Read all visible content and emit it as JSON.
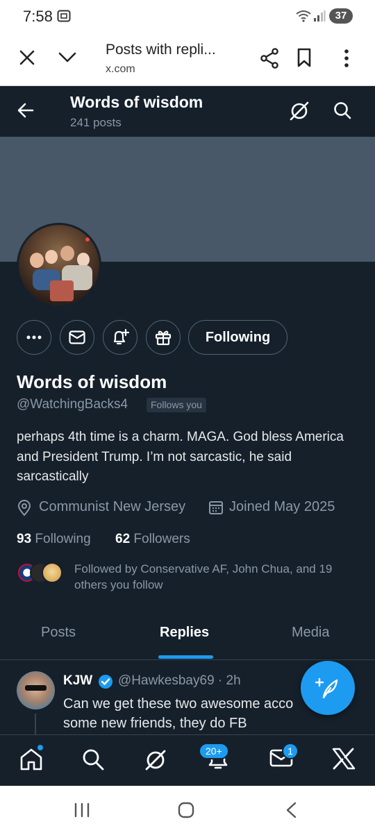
{
  "status_bar": {
    "time": "7:58",
    "battery": "37"
  },
  "browser": {
    "title": "Posts with repli...",
    "url": "x.com"
  },
  "profile_header": {
    "title": "Words of wisdom",
    "post_count": "241 posts"
  },
  "profile": {
    "name": "Words of wisdom",
    "handle": "@WatchingBacks4",
    "follows_you": "Follows you",
    "following_button": "Following",
    "bio": "perhaps 4th time is a charm. MAGA. God bless America and President Trump. I’m not sarcastic, he said sarcastically",
    "location": "Communist New Jersey",
    "joined": "Joined May 2025",
    "following_count": "93",
    "following_label": "Following",
    "followers_count": "62",
    "followers_label": "Followers",
    "followed_by": "Followed by Conservative AF, John Chua, and 19 others you follow"
  },
  "tabs": [
    "Posts",
    "Replies",
    "Media"
  ],
  "active_tab": "Replies",
  "tweet": {
    "name": "KJW",
    "handle_time": "@Hawkesbay69 · 2h",
    "text_line1": "Can we get these two awesome acco",
    "text_line2": "some new friends, they do FB"
  },
  "bottom_nav": {
    "notifications_badge": "20+",
    "messages_badge": "1"
  },
  "colors": {
    "background": "#15202b",
    "accent": "#1d9bf0",
    "muted": "#8b98a5",
    "banner": "#485868"
  }
}
